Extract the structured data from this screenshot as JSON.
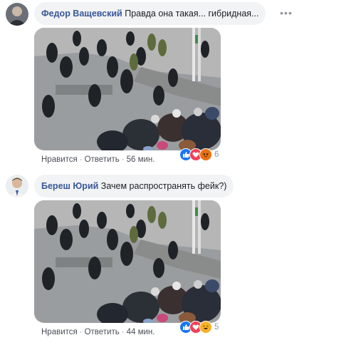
{
  "comments": [
    {
      "author": "Федор Ващевский",
      "text": "Правда она такая... гибридная...",
      "more_icon": "ellipsis-icon",
      "actions": {
        "like": "Нравится",
        "reply": "Ответить",
        "separator": "·",
        "time": "56 мин."
      },
      "reactions": {
        "types": [
          "like",
          "love",
          "angry"
        ],
        "count": "6"
      }
    },
    {
      "author": "Береш Юрий",
      "text": "Зачем распространять фейк?)",
      "actions": {
        "like": "Нравится",
        "reply": "Ответить",
        "separator": "·",
        "time": "44 мин."
      },
      "reactions": {
        "types": [
          "like",
          "love",
          "haha"
        ],
        "count": "5"
      }
    }
  ],
  "colors": {
    "link": "#385898",
    "bubble": "#f2f3f5",
    "meta": "#90949c",
    "like": "#1877f2",
    "love": "#f33e58",
    "angry": "#e9710f",
    "haha": "#f7b125"
  }
}
